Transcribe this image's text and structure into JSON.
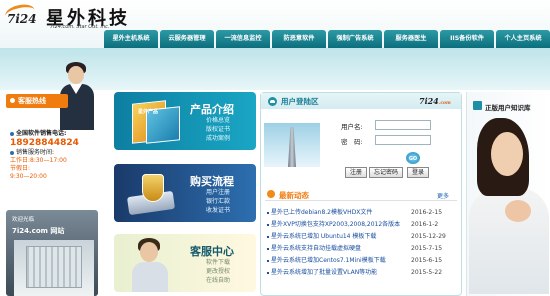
{
  "header": {
    "logo_number": "7i24",
    "logo_tagline": "",
    "brand_name": "星外科技",
    "brand_sub": "7i24.com. Star Out. Inc."
  },
  "nav": {
    "items": [
      {
        "label": "星外主机系统"
      },
      {
        "label": "云服务器管理"
      },
      {
        "label": "一流信息监控"
      },
      {
        "label": "防恶意软件"
      },
      {
        "label": "强制广告系统"
      },
      {
        "label": "服务器医生"
      },
      {
        "label": "IIS备份软件"
      },
      {
        "label": "个人主页系统"
      }
    ]
  },
  "left": {
    "service_title": "客服热线",
    "phone_label": "全国软件销售电话:",
    "phone_number": "18928844824",
    "hours_label": "销售服务时间:",
    "hours_work": "工作日:8:30—17:00",
    "hours_holiday": "节假日:",
    "hours_holiday_time": "9:30—20:00",
    "welcome_text": "欢迎光临",
    "welcome_site": "7i24.com 网站"
  },
  "promos": [
    {
      "title": "产品介绍",
      "items": [
        "价格总览",
        "版权证书",
        "成功案例"
      ],
      "box_label": "星外产品"
    },
    {
      "title": "购买流程",
      "items": [
        "用户注册",
        "银行汇款",
        "收发证书"
      ]
    },
    {
      "title": "客服中心",
      "items": [
        "软件下载",
        "更改授权",
        "在线自助"
      ]
    }
  ],
  "login": {
    "title": "用户登陆区",
    "logo": "7i24",
    "logo_suffix": ".com",
    "username_label": "用户名:",
    "password_label": "密　码:",
    "go_label": "GO",
    "register_label": "注册",
    "forgot_label": "忘记密码",
    "login_label": "登录"
  },
  "news": {
    "title": "最新动态",
    "more": "更多",
    "items": [
      {
        "title": "星外已上传debian8.2模板VHDX文件",
        "date": "2016-2-15"
      },
      {
        "title": "星外XVP切换包支持XP2003,2008,2012各版本",
        "date": "2016-1-2"
      },
      {
        "title": "星外云系统已增加 Ubuntu14 模板下载",
        "date": "2015-12-29"
      },
      {
        "title": "星外云系统支持自动挂载虚拟硬盘",
        "date": "2015-7-15"
      },
      {
        "title": "星外云系统已增加Centos7.1Mini模板下载",
        "date": "2015-6-15"
      },
      {
        "title": "星外云系统增加了批量设置VLAN等功能",
        "date": "2015-5-22"
      }
    ]
  },
  "right": {
    "title": "正版用户知识库"
  }
}
